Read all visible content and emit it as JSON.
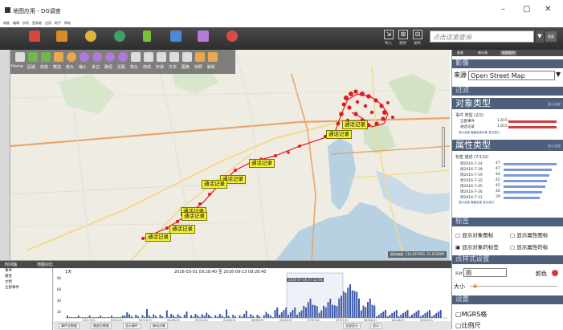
{
  "window": {
    "title": "地图应用 - DG调查",
    "minimize": "–",
    "maximize": "▢",
    "close": "✕"
  },
  "menu": [
    "调查",
    "编辑",
    "杂项",
    "登录者",
    "应用",
    "助手",
    "帮助"
  ],
  "ribbon": {
    "icons": [
      {
        "name": "home",
        "color": "#d9463b"
      },
      {
        "name": "briefcase",
        "color": "#d98b2a"
      },
      {
        "name": "people",
        "color": "#e0b43a"
      },
      {
        "name": "globe",
        "color": "#3fa068"
      },
      {
        "name": "chart",
        "color": "#7cbf3a"
      },
      {
        "name": "folder",
        "color": "#4a8ad0"
      },
      {
        "name": "puzzle",
        "color": "#b87ad8"
      },
      {
        "name": "network",
        "color": "#d84a4a"
      }
    ],
    "tools": [
      {
        "glyph": "⇲",
        "label": "导入"
      },
      {
        "glyph": "⊞",
        "label": "更新"
      },
      {
        "glyph": "⊟",
        "label": "发布"
      }
    ],
    "search_placeholder": "点击这里查询",
    "search_btn": "搜索"
  },
  "map_toolbar": [
    "Home",
    "回退",
    "前进",
    "截选",
    "放大",
    "缩小",
    "多边",
    "路径",
    "近距",
    "箭头",
    "箭线",
    "形状",
    "文本",
    "图像",
    "快照",
    "解析"
  ],
  "map": {
    "coords": "鼠标缩放: 114.067093, 21.932609",
    "callouts": [
      {
        "text": "通话记录",
        "left": 413,
        "top": 88
      },
      {
        "text": "通话记录",
        "left": 393,
        "top": 100
      },
      {
        "text": "通话记录",
        "left": 297,
        "top": 136
      },
      {
        "text": "通话记录",
        "left": 261,
        "top": 156
      },
      {
        "text": "通话记录",
        "left": 238,
        "top": 162
      },
      {
        "text": "通话记录",
        "left": 212,
        "top": 196
      },
      {
        "text": "通话记录",
        "left": 213,
        "top": 202
      },
      {
        "text": "通话记录",
        "left": 198,
        "top": 218
      },
      {
        "text": "通话记录",
        "left": 168,
        "top": 228
      }
    ]
  },
  "right_panel": {
    "tabs": [
      "图表",
      "统计表",
      "地图细节"
    ],
    "imagery_header": "影像",
    "source_label": "来源",
    "source_value": "Open Street Map",
    "filter_header": "过滤",
    "object_type_header": "对象类型",
    "object_type_link": "显示全部",
    "event_type_label": "事件 类型 (2/2)",
    "event_items": [
      {
        "label": "全部事件",
        "count": "1,615",
        "fill": 0.95
      },
      {
        "label": "通话记录",
        "count": "1,615",
        "fill": 0.95
      }
    ],
    "object_links": "显示全部  隐藏全部对象  显示统计",
    "attr_type_header": "属性类型",
    "attr_type_link": "显示全部",
    "attr_group_label": "标签 描述 (7/132)",
    "attr_items": [
      {
        "label": "周2016-7-14",
        "count": "47",
        "fill": 0.55
      },
      {
        "label": "周2016-7-18",
        "count": "47",
        "fill": 0.5
      },
      {
        "label": "周2016-7-19",
        "count": "44",
        "fill": 0.48
      },
      {
        "label": "周2016-7-15",
        "count": "42",
        "fill": 0.45
      },
      {
        "label": "周2016-7-25",
        "count": "42",
        "fill": 0.43
      },
      {
        "label": "周2016-7-26",
        "count": "40",
        "fill": 0.4
      },
      {
        "label": "周2016-7-11",
        "count": "39",
        "fill": 0.38
      }
    ],
    "attr_links": "显示全部  隐藏全部  显示统计",
    "label_header": "标签",
    "label_opts": [
      "显示对象图标",
      "显示属性图标",
      "显示对象的标签",
      "显示属性的标"
    ],
    "point_style_header": "点样式设置",
    "shape_label": "形状",
    "shape_value": "圆",
    "color_label": "颜色",
    "size_label": "大小",
    "settings_header": "设置",
    "mgrs": "MGRS格",
    "scale": "比例尺"
  },
  "bottom": {
    "tabs": [
      "时间轴",
      "地图对比"
    ],
    "tree": [
      "事件",
      "属性",
      "文档",
      "全部事件"
    ],
    "hist_header_left": "1天",
    "hist_range": "2016-03-01 09:28:40  至  2016-09-13 09:28:40",
    "tooltip": "2016-07-06  07:12:04",
    "y_ticks": [
      "90",
      "60",
      "40",
      "20"
    ],
    "x_ticks": [
      "03/17(U)",
      "03/31(U)",
      "04/14(U)",
      "04/28(U)",
      "05/12(U)",
      "05/26(U)",
      "06/09(U)",
      "06/23(U)",
      "07/07(U)",
      "07/21(U)",
      "08/04(U)",
      "08/18(U)",
      "09/01(U)"
    ],
    "buttons": [
      "事件总数据",
      "缩放总数据",
      "显示事件",
      "移动对象",
      "全部显示",
      "显示"
    ]
  }
}
